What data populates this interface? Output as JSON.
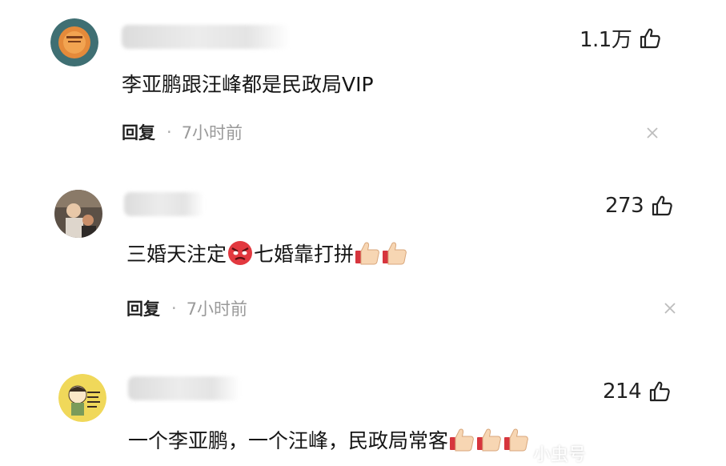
{
  "comments": [
    {
      "likes": "1.1万",
      "text": "李亚鹏跟汪峰都是民政局VIP",
      "reply_label": "回复",
      "separator": "·",
      "time": "7小时前"
    },
    {
      "likes": "273",
      "text_part1": "三婚天注定",
      "text_part2": "七婚靠打拼",
      "reply_label": "回复",
      "separator": "·",
      "time": "7小时前"
    },
    {
      "likes": "214",
      "text": "一个李亚鹏，一个汪峰，民政局常客"
    }
  ],
  "watermark": "小虫号",
  "icons": {
    "like": "thumbs-up-icon",
    "dismiss": "close-icon",
    "emoji_angry": "angry-face-emoji",
    "emoji_thumb": "thumbs-up-emoji"
  },
  "colors": {
    "text": "#151515",
    "meta_gray": "#9a9a9a",
    "background": "#ffffff"
  }
}
